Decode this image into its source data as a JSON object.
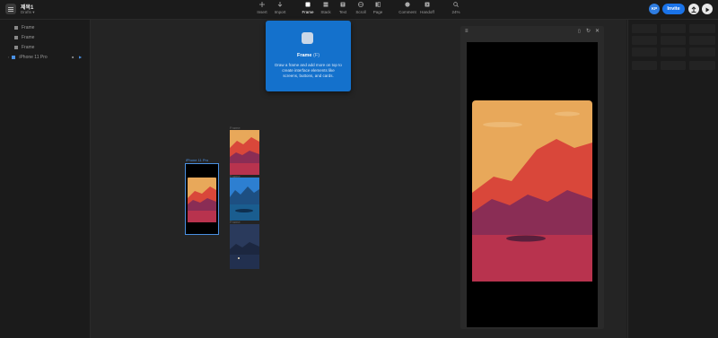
{
  "document": {
    "title": "제목1",
    "subtitle": "Drafts ▾"
  },
  "toolbar": {
    "tools": [
      {
        "label": "Insert",
        "icon": "plus-icon"
      },
      {
        "label": "Import",
        "icon": "arrow-down-icon"
      },
      {
        "label": "Frame",
        "icon": "frame-icon"
      },
      {
        "label": "Stack",
        "icon": "stack-icon"
      },
      {
        "label": "Text",
        "icon": "text-icon"
      },
      {
        "label": "Scroll",
        "icon": "scroll-icon"
      },
      {
        "label": "Page",
        "icon": "page-icon"
      },
      {
        "label": "Comment",
        "icon": "comment-icon"
      },
      {
        "label": "Handoff",
        "icon": "handoff-icon"
      }
    ],
    "zoom": "24%",
    "avatar_initials": "KP",
    "invite_label": "Invite"
  },
  "layers": [
    {
      "label": "Frame"
    },
    {
      "label": "Frame"
    },
    {
      "label": "Frame"
    },
    {
      "label": "iPhone 11 Pro"
    }
  ],
  "tooltip": {
    "title": "Frame",
    "shortcut": "(F)",
    "description": "Draw a frame and add more on top to create interface elements like screens, buttons, and cards."
  },
  "canvas": {
    "selected_frame_label": "iPhone 11 Pro",
    "frame_labels": [
      "Frame",
      "Frame",
      "Frame"
    ]
  },
  "colors": {
    "accent": "#1a73e8",
    "tooltip_bg": "#1471cc",
    "sky": "#e8a85a",
    "mountain_red": "#d9473a",
    "water": "#b8334e"
  }
}
